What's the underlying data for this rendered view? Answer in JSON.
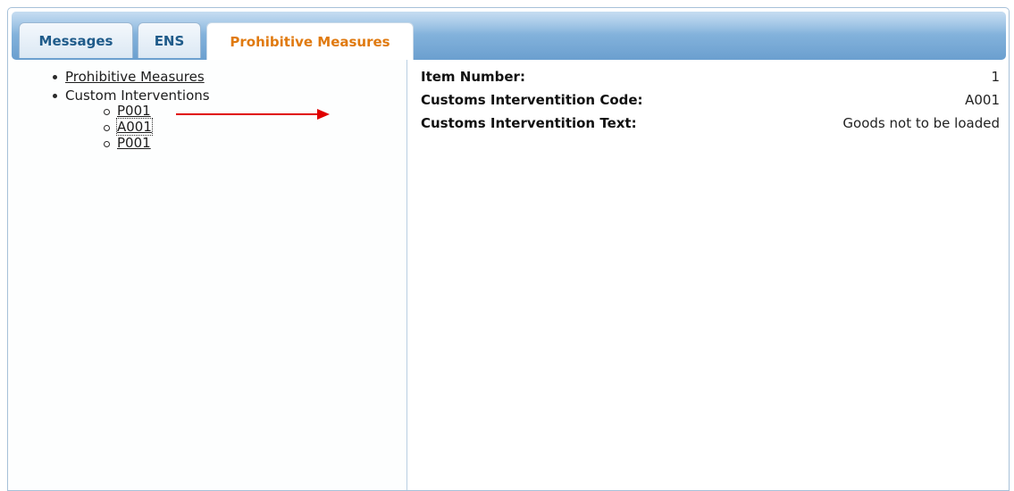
{
  "tabs": [
    {
      "label": "Messages",
      "active": false
    },
    {
      "label": "ENS",
      "active": false
    },
    {
      "label": "Prohibitive Measures",
      "active": true
    }
  ],
  "tree": {
    "root_link": "Prohibitive Measures",
    "group_label": "Custom Interventions",
    "children": [
      "P001",
      "A001",
      "P001"
    ],
    "selected_index": 1
  },
  "details": {
    "item_number_label": "Item Number:",
    "item_number_value": "1",
    "code_label": "Customs Interventition Code:",
    "code_value": "A001",
    "text_label": "Customs Interventition Text:",
    "text_value": "Goods not to be loaded"
  },
  "colors": {
    "active_tab_text": "#e07a10",
    "inactive_tab_text": "#1f5b8a",
    "annotation_arrow": "#e00000",
    "tab_bar": "#84b3dc"
  }
}
